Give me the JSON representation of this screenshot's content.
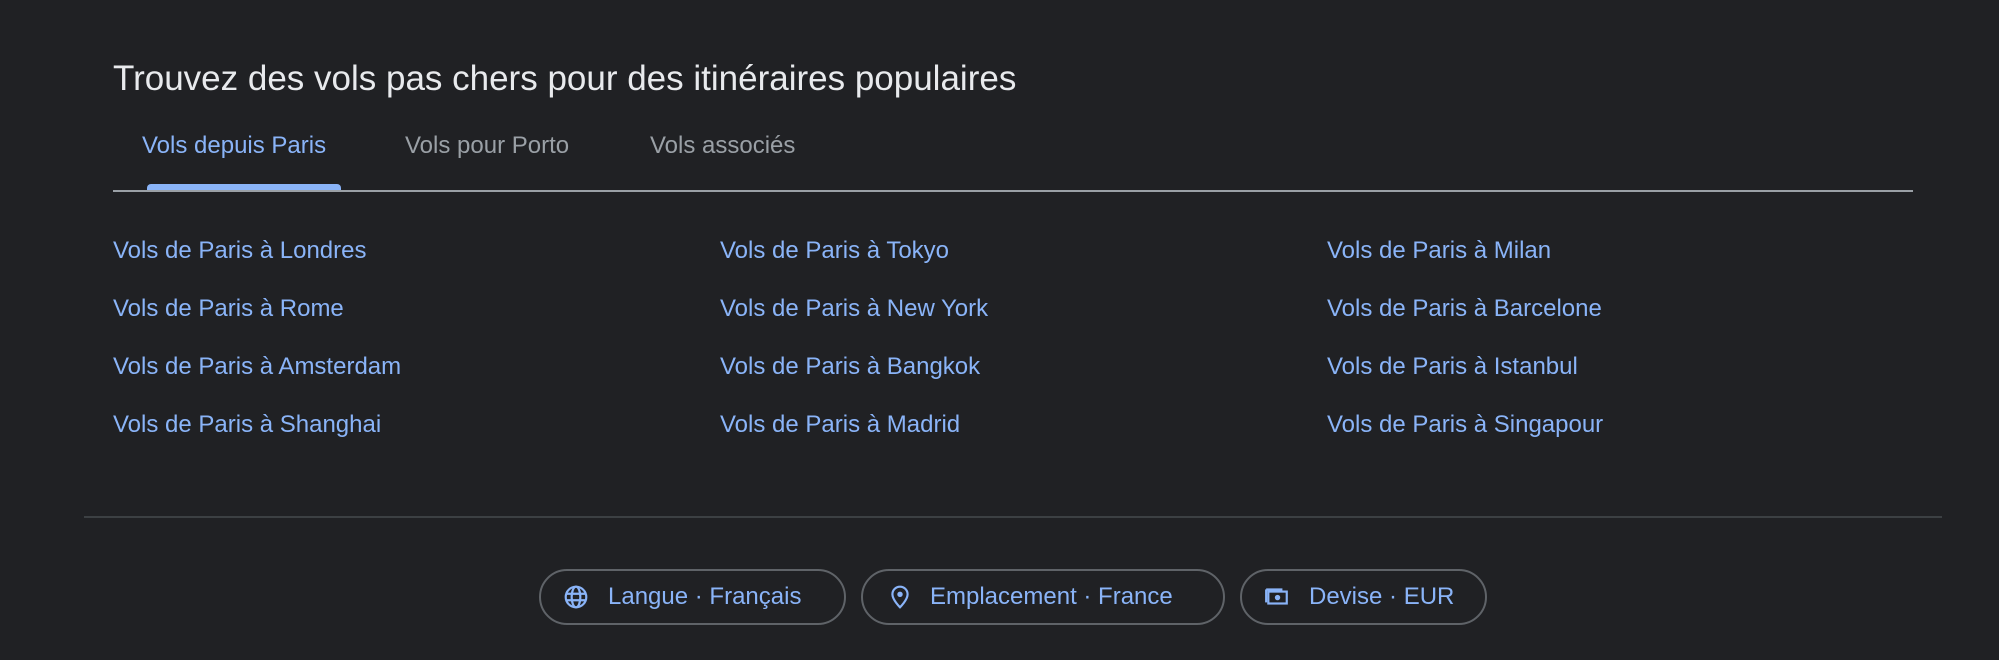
{
  "heading": "Trouvez des vols pas chers pour des itinéraires populaires",
  "tabs": [
    {
      "label": "Vols depuis Paris",
      "selected": true
    },
    {
      "label": "Vols pour Porto",
      "selected": false
    },
    {
      "label": "Vols associés",
      "selected": false
    }
  ],
  "links": {
    "col1": [
      "Vols de Paris à Londres",
      "Vols de Paris à Rome",
      "Vols de Paris à Amsterdam",
      "Vols de Paris à Shanghai"
    ],
    "col2": [
      "Vols de Paris à Tokyo",
      "Vols de Paris à New York",
      "Vols de Paris à Bangkok",
      "Vols de Paris à Madrid"
    ],
    "col3": [
      "Vols de Paris à Milan",
      "Vols de Paris à Barcelone",
      "Vols de Paris à Istanbul",
      "Vols de Paris à Singapour"
    ]
  },
  "footer": {
    "chips": [
      {
        "label": "Langue · Français",
        "icon": "globe-icon"
      },
      {
        "label": "Emplacement · France",
        "icon": "location-pin-icon"
      },
      {
        "label": "Devise · EUR",
        "icon": "currency-icon"
      }
    ]
  },
  "colors": {
    "background": "#202124",
    "heading": "#e8eaed",
    "accent": "#8ab4f8",
    "muted": "#9aa0a6",
    "border": "#5f6368"
  }
}
